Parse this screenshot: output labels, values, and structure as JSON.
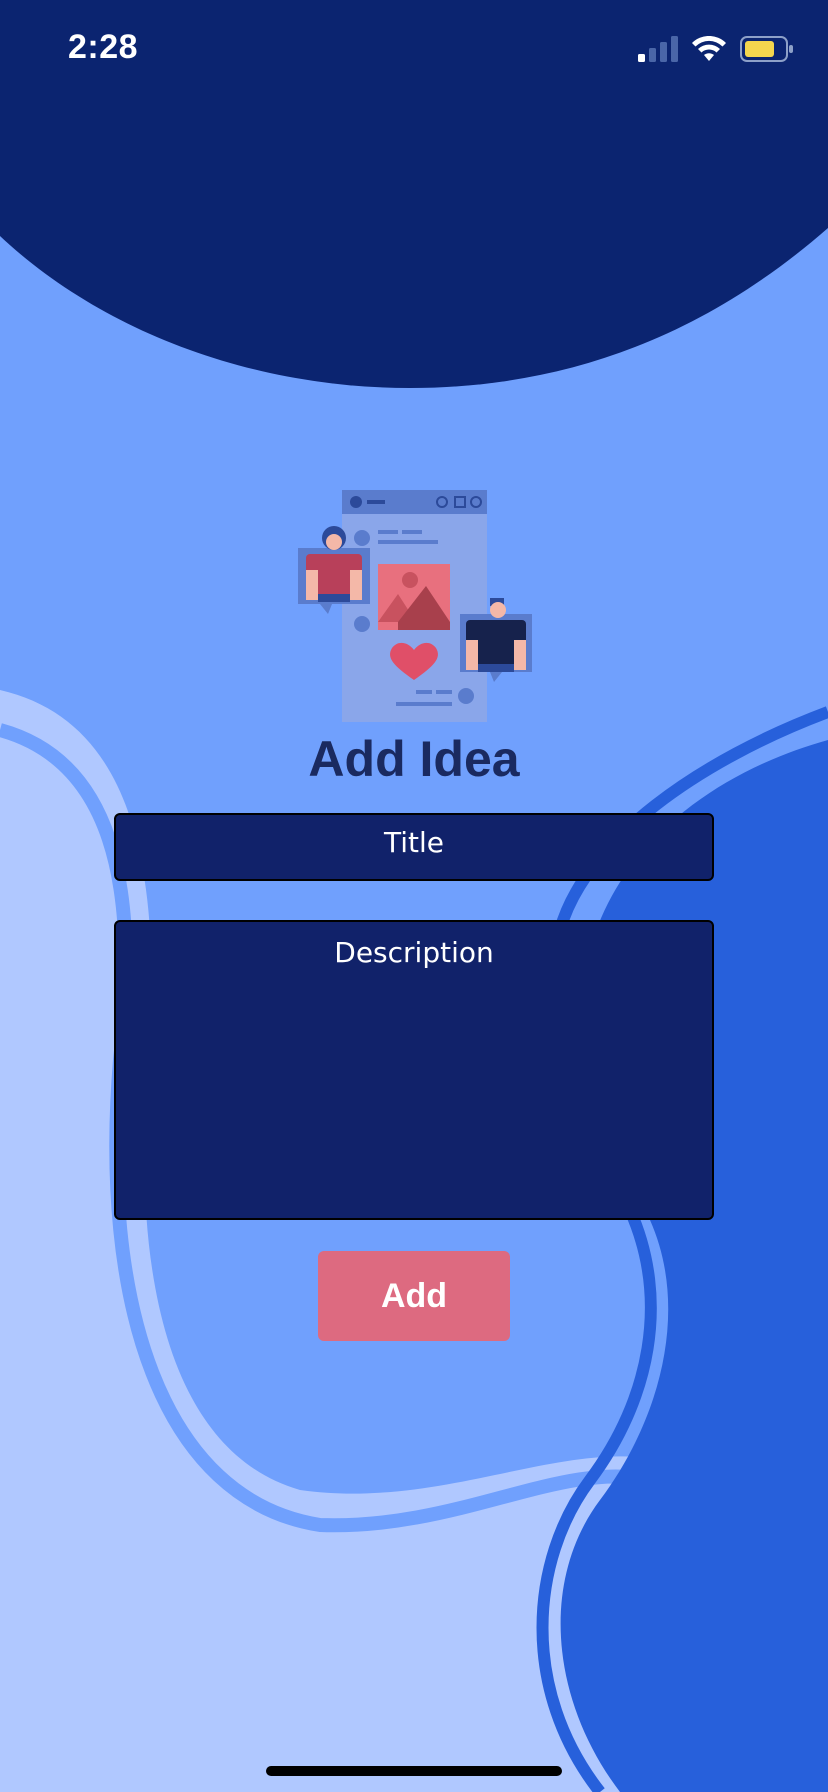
{
  "status_bar": {
    "time": "2:28",
    "icons": [
      "cellular-signal-icon",
      "wifi-icon",
      "battery-icon"
    ],
    "battery_color": "#f4d64e"
  },
  "illustration": {
    "name": "social-media-post-illustration"
  },
  "page": {
    "title": "Add Idea"
  },
  "form": {
    "title_placeholder": "Title",
    "description_placeholder": "Description",
    "add_label": "Add"
  },
  "colors": {
    "header_dark": "#0b2470",
    "background_mid": "#70a0fd",
    "background_light": "#b0c8ff",
    "accent_blue": "#2760db",
    "field_bg": "#11226a",
    "button_pink": "#dd6a80",
    "title_text": "#1a2a60"
  }
}
